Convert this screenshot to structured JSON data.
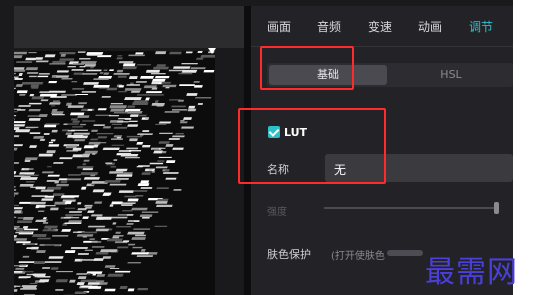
{
  "panel": {
    "tabs": [
      {
        "label": "画面",
        "active": false
      },
      {
        "label": "音频",
        "active": false
      },
      {
        "label": "变速",
        "active": false
      },
      {
        "label": "动画",
        "active": false
      },
      {
        "label": "调节",
        "active": true
      }
    ],
    "segments": [
      {
        "label": "基础",
        "active": true
      },
      {
        "label": "HSL",
        "active": false
      }
    ],
    "lut": {
      "label": "LUT",
      "checked": true
    },
    "name_field": {
      "label": "名称",
      "value": "无"
    },
    "intensity": {
      "label": "强度",
      "level": 1.0
    },
    "skin_protect": {
      "label": "肤色保护",
      "hint": "(打开使肤色"
    }
  },
  "colors": {
    "accent": "#2bc0ca",
    "highlight_box": "#ff2b2b",
    "watermark": "#4b3fd9"
  },
  "watermark": "最需网"
}
